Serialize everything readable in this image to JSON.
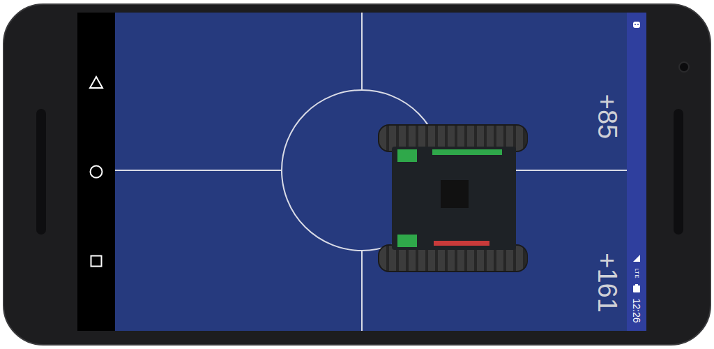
{
  "readouts": [
    {
      "value": "+85"
    },
    {
      "value": "+161"
    }
  ],
  "status_bar": {
    "network": "LTE",
    "time": "12:26"
  }
}
